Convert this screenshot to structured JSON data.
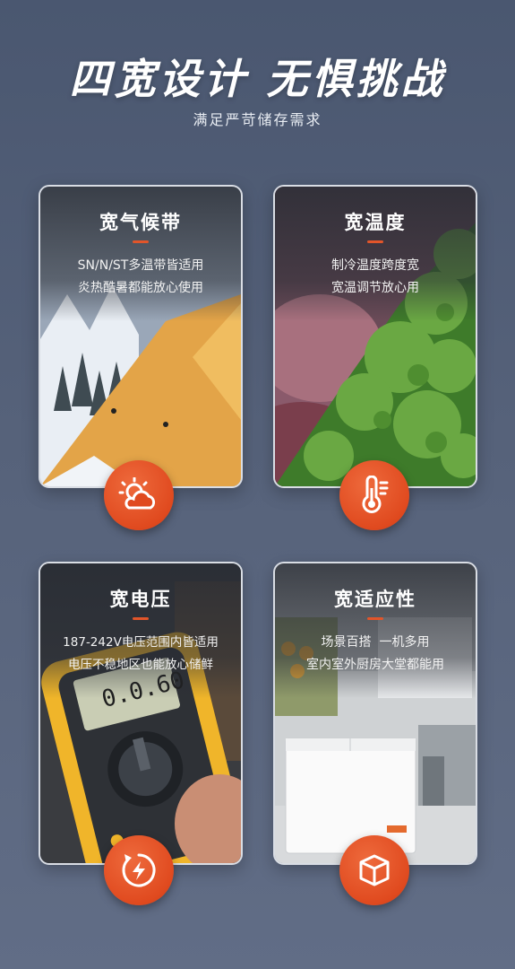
{
  "header": {
    "title": "四宽设计 无惧挑战",
    "subtitle": "满足严苛储存需求"
  },
  "cards": [
    {
      "title": "宽气候带",
      "lines": [
        "SN/N/ST多温带皆适用",
        "炎热酷暑都能放心使用"
      ],
      "icon": "sun-cloud-icon"
    },
    {
      "title": "宽温度",
      "lines": [
        "制冷温度跨度宽",
        "宽温调节放心用"
      ],
      "icon": "thermometer-icon"
    },
    {
      "title": "宽电压",
      "lines": [
        "187-242V电压范围内皆适用",
        "电压不稳地区也能放心储鲜"
      ],
      "icon": "power-cycle-icon",
      "meter_reading": "0.0.60"
    },
    {
      "title": "宽适应性",
      "lines": [
        "场景百搭  一机多用",
        "室内室外厨房大堂都能用"
      ],
      "icon": "box-icon"
    }
  ],
  "colors": {
    "accent": "#e2552a",
    "background": "#56627a"
  }
}
